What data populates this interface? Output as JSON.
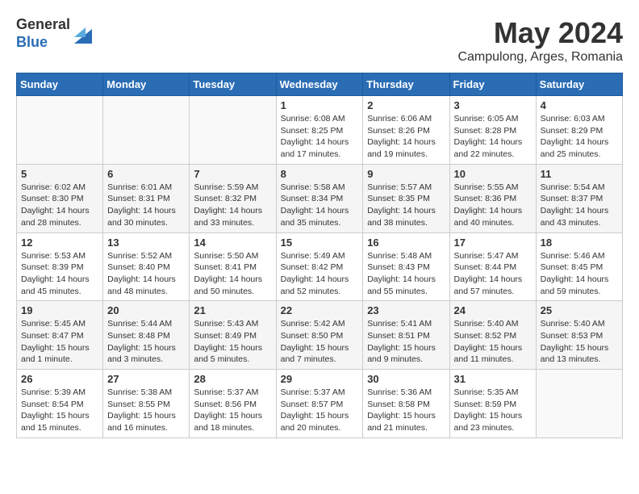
{
  "header": {
    "logo_general": "General",
    "logo_blue": "Blue",
    "month_title": "May 2024",
    "location": "Campulong, Arges, Romania"
  },
  "days_of_week": [
    "Sunday",
    "Monday",
    "Tuesday",
    "Wednesday",
    "Thursday",
    "Friday",
    "Saturday"
  ],
  "weeks": [
    [
      {
        "num": "",
        "info": ""
      },
      {
        "num": "",
        "info": ""
      },
      {
        "num": "",
        "info": ""
      },
      {
        "num": "1",
        "info": "Sunrise: 6:08 AM\nSunset: 8:25 PM\nDaylight: 14 hours and 17 minutes."
      },
      {
        "num": "2",
        "info": "Sunrise: 6:06 AM\nSunset: 8:26 PM\nDaylight: 14 hours and 19 minutes."
      },
      {
        "num": "3",
        "info": "Sunrise: 6:05 AM\nSunset: 8:28 PM\nDaylight: 14 hours and 22 minutes."
      },
      {
        "num": "4",
        "info": "Sunrise: 6:03 AM\nSunset: 8:29 PM\nDaylight: 14 hours and 25 minutes."
      }
    ],
    [
      {
        "num": "5",
        "info": "Sunrise: 6:02 AM\nSunset: 8:30 PM\nDaylight: 14 hours and 28 minutes."
      },
      {
        "num": "6",
        "info": "Sunrise: 6:01 AM\nSunset: 8:31 PM\nDaylight: 14 hours and 30 minutes."
      },
      {
        "num": "7",
        "info": "Sunrise: 5:59 AM\nSunset: 8:32 PM\nDaylight: 14 hours and 33 minutes."
      },
      {
        "num": "8",
        "info": "Sunrise: 5:58 AM\nSunset: 8:34 PM\nDaylight: 14 hours and 35 minutes."
      },
      {
        "num": "9",
        "info": "Sunrise: 5:57 AM\nSunset: 8:35 PM\nDaylight: 14 hours and 38 minutes."
      },
      {
        "num": "10",
        "info": "Sunrise: 5:55 AM\nSunset: 8:36 PM\nDaylight: 14 hours and 40 minutes."
      },
      {
        "num": "11",
        "info": "Sunrise: 5:54 AM\nSunset: 8:37 PM\nDaylight: 14 hours and 43 minutes."
      }
    ],
    [
      {
        "num": "12",
        "info": "Sunrise: 5:53 AM\nSunset: 8:39 PM\nDaylight: 14 hours and 45 minutes."
      },
      {
        "num": "13",
        "info": "Sunrise: 5:52 AM\nSunset: 8:40 PM\nDaylight: 14 hours and 48 minutes."
      },
      {
        "num": "14",
        "info": "Sunrise: 5:50 AM\nSunset: 8:41 PM\nDaylight: 14 hours and 50 minutes."
      },
      {
        "num": "15",
        "info": "Sunrise: 5:49 AM\nSunset: 8:42 PM\nDaylight: 14 hours and 52 minutes."
      },
      {
        "num": "16",
        "info": "Sunrise: 5:48 AM\nSunset: 8:43 PM\nDaylight: 14 hours and 55 minutes."
      },
      {
        "num": "17",
        "info": "Sunrise: 5:47 AM\nSunset: 8:44 PM\nDaylight: 14 hours and 57 minutes."
      },
      {
        "num": "18",
        "info": "Sunrise: 5:46 AM\nSunset: 8:45 PM\nDaylight: 14 hours and 59 minutes."
      }
    ],
    [
      {
        "num": "19",
        "info": "Sunrise: 5:45 AM\nSunset: 8:47 PM\nDaylight: 15 hours and 1 minute."
      },
      {
        "num": "20",
        "info": "Sunrise: 5:44 AM\nSunset: 8:48 PM\nDaylight: 15 hours and 3 minutes."
      },
      {
        "num": "21",
        "info": "Sunrise: 5:43 AM\nSunset: 8:49 PM\nDaylight: 15 hours and 5 minutes."
      },
      {
        "num": "22",
        "info": "Sunrise: 5:42 AM\nSunset: 8:50 PM\nDaylight: 15 hours and 7 minutes."
      },
      {
        "num": "23",
        "info": "Sunrise: 5:41 AM\nSunset: 8:51 PM\nDaylight: 15 hours and 9 minutes."
      },
      {
        "num": "24",
        "info": "Sunrise: 5:40 AM\nSunset: 8:52 PM\nDaylight: 15 hours and 11 minutes."
      },
      {
        "num": "25",
        "info": "Sunrise: 5:40 AM\nSunset: 8:53 PM\nDaylight: 15 hours and 13 minutes."
      }
    ],
    [
      {
        "num": "26",
        "info": "Sunrise: 5:39 AM\nSunset: 8:54 PM\nDaylight: 15 hours and 15 minutes."
      },
      {
        "num": "27",
        "info": "Sunrise: 5:38 AM\nSunset: 8:55 PM\nDaylight: 15 hours and 16 minutes."
      },
      {
        "num": "28",
        "info": "Sunrise: 5:37 AM\nSunset: 8:56 PM\nDaylight: 15 hours and 18 minutes."
      },
      {
        "num": "29",
        "info": "Sunrise: 5:37 AM\nSunset: 8:57 PM\nDaylight: 15 hours and 20 minutes."
      },
      {
        "num": "30",
        "info": "Sunrise: 5:36 AM\nSunset: 8:58 PM\nDaylight: 15 hours and 21 minutes."
      },
      {
        "num": "31",
        "info": "Sunrise: 5:35 AM\nSunset: 8:59 PM\nDaylight: 15 hours and 23 minutes."
      },
      {
        "num": "",
        "info": ""
      }
    ]
  ]
}
